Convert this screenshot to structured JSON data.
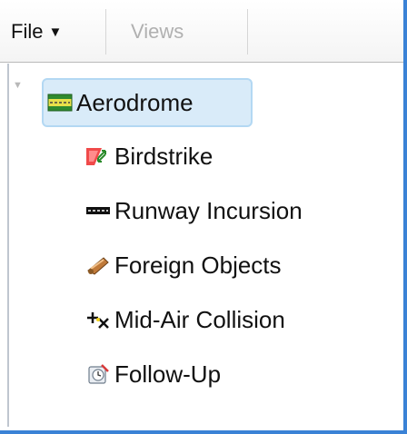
{
  "toolbar": {
    "file_label": "File",
    "views_label": "Views"
  },
  "tree": {
    "root": {
      "label": "Aerodrome",
      "icon": "aerodrome-icon",
      "expanded": true,
      "selected": true
    },
    "children": [
      {
        "label": "Birdstrike",
        "icon": "birdstrike-icon"
      },
      {
        "label": "Runway Incursion",
        "icon": "runway-icon"
      },
      {
        "label": "Foreign Objects",
        "icon": "foreign-object-icon"
      },
      {
        "label": "Mid-Air Collision",
        "icon": "collision-icon"
      },
      {
        "label": "Follow-Up",
        "icon": "follow-up-icon"
      }
    ]
  },
  "colors": {
    "window_border": "#3a82d6",
    "selection_bg": "#d9ebf9",
    "selection_border": "#b3d8f3",
    "disabled_text": "#b0b0b0"
  }
}
